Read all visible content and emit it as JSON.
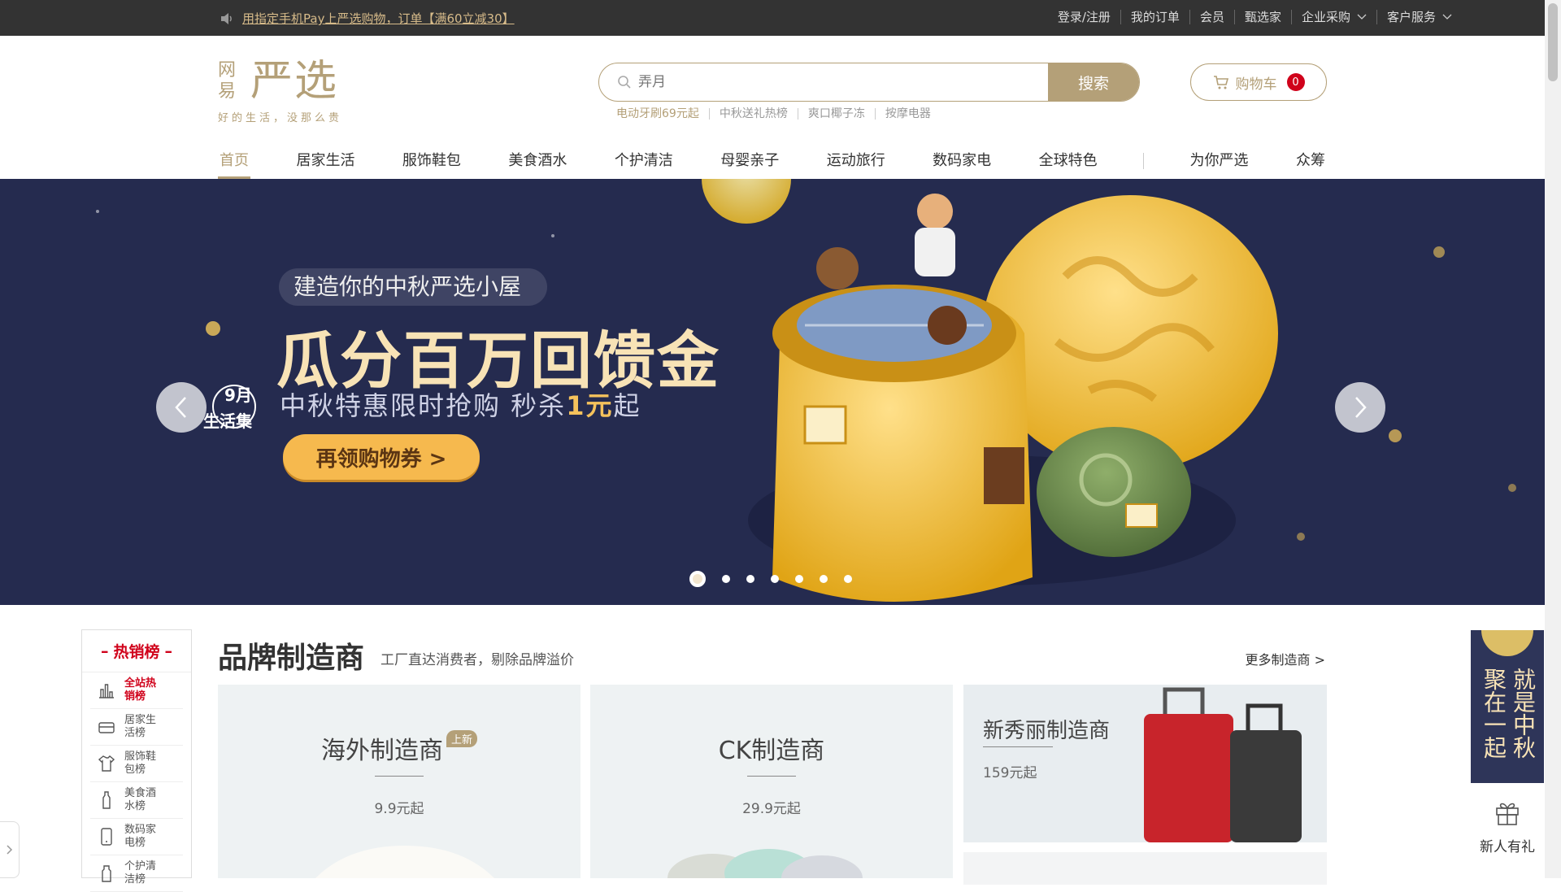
{
  "topbar": {
    "notice": "用指定手机Pay上严选购物，订单【满60立减30】",
    "links": [
      {
        "label": "登录/注册",
        "dropdown": false
      },
      {
        "label": "我的订单",
        "dropdown": false
      },
      {
        "label": "会员",
        "dropdown": false
      },
      {
        "label": "甄选家",
        "dropdown": false
      },
      {
        "label": "企业采购",
        "dropdown": true
      },
      {
        "label": "客户服务",
        "dropdown": true
      }
    ]
  },
  "header": {
    "logo_small": "网易",
    "logo_big": "严选",
    "slogan": "好的生活，没那么贵",
    "search_placeholder": "弄月",
    "search_button": "搜索",
    "hotwords": [
      "电动牙刷69元起",
      "中秋送礼热榜",
      "爽口椰子冻",
      "按摩电器"
    ],
    "cart_label": "购物车",
    "cart_count": "0"
  },
  "nav": [
    "首页",
    "居家生活",
    "服饰鞋包",
    "美食酒水",
    "个护清洁",
    "母婴亲子",
    "运动旅行",
    "数码家电",
    "全球特色",
    "为你严选",
    "众筹"
  ],
  "banner": {
    "badge_num": "9月",
    "badge_text": "生活集",
    "subtitle": "建造你的中秋严选小屋",
    "title": "瓜分百万回馈金",
    "line_pre": "中秋特惠限时抢购 秒杀",
    "line_hl": "1元",
    "line_post": "起",
    "cta": "再领购物券 >",
    "slides": 7,
    "active_slide": 1
  },
  "hotlist": {
    "title": "热销榜",
    "items": [
      {
        "label": "全站热销榜",
        "icon": "bar-chart-icon"
      },
      {
        "label": "居家生活榜",
        "icon": "sofa-icon"
      },
      {
        "label": "服饰鞋包榜",
        "icon": "shirt-icon"
      },
      {
        "label": "美食酒水榜",
        "icon": "bottle-icon"
      },
      {
        "label": "数码家电榜",
        "icon": "phone-icon"
      },
      {
        "label": "个护清洁榜",
        "icon": "cleaning-icon"
      }
    ]
  },
  "brand": {
    "title": "品牌制造商",
    "desc": "工厂直达消费者，剔除品牌溢价",
    "more": "更多制造商 >",
    "cards": [
      {
        "name": "海外制造商",
        "tag": "上新",
        "price": "9.9元起"
      },
      {
        "name": "CK制造商",
        "price": "29.9元起"
      },
      {
        "name": "新秀丽制造商",
        "price": "159元起"
      }
    ]
  },
  "float": {
    "ad_col1": "就是中秋",
    "ad_col2": "聚在一起",
    "gift_label": "新人有礼"
  },
  "colors": {
    "accent": "#b4a078",
    "topbar": "#333333",
    "banner_bg": "#252b4f",
    "red": "#d0021b"
  }
}
